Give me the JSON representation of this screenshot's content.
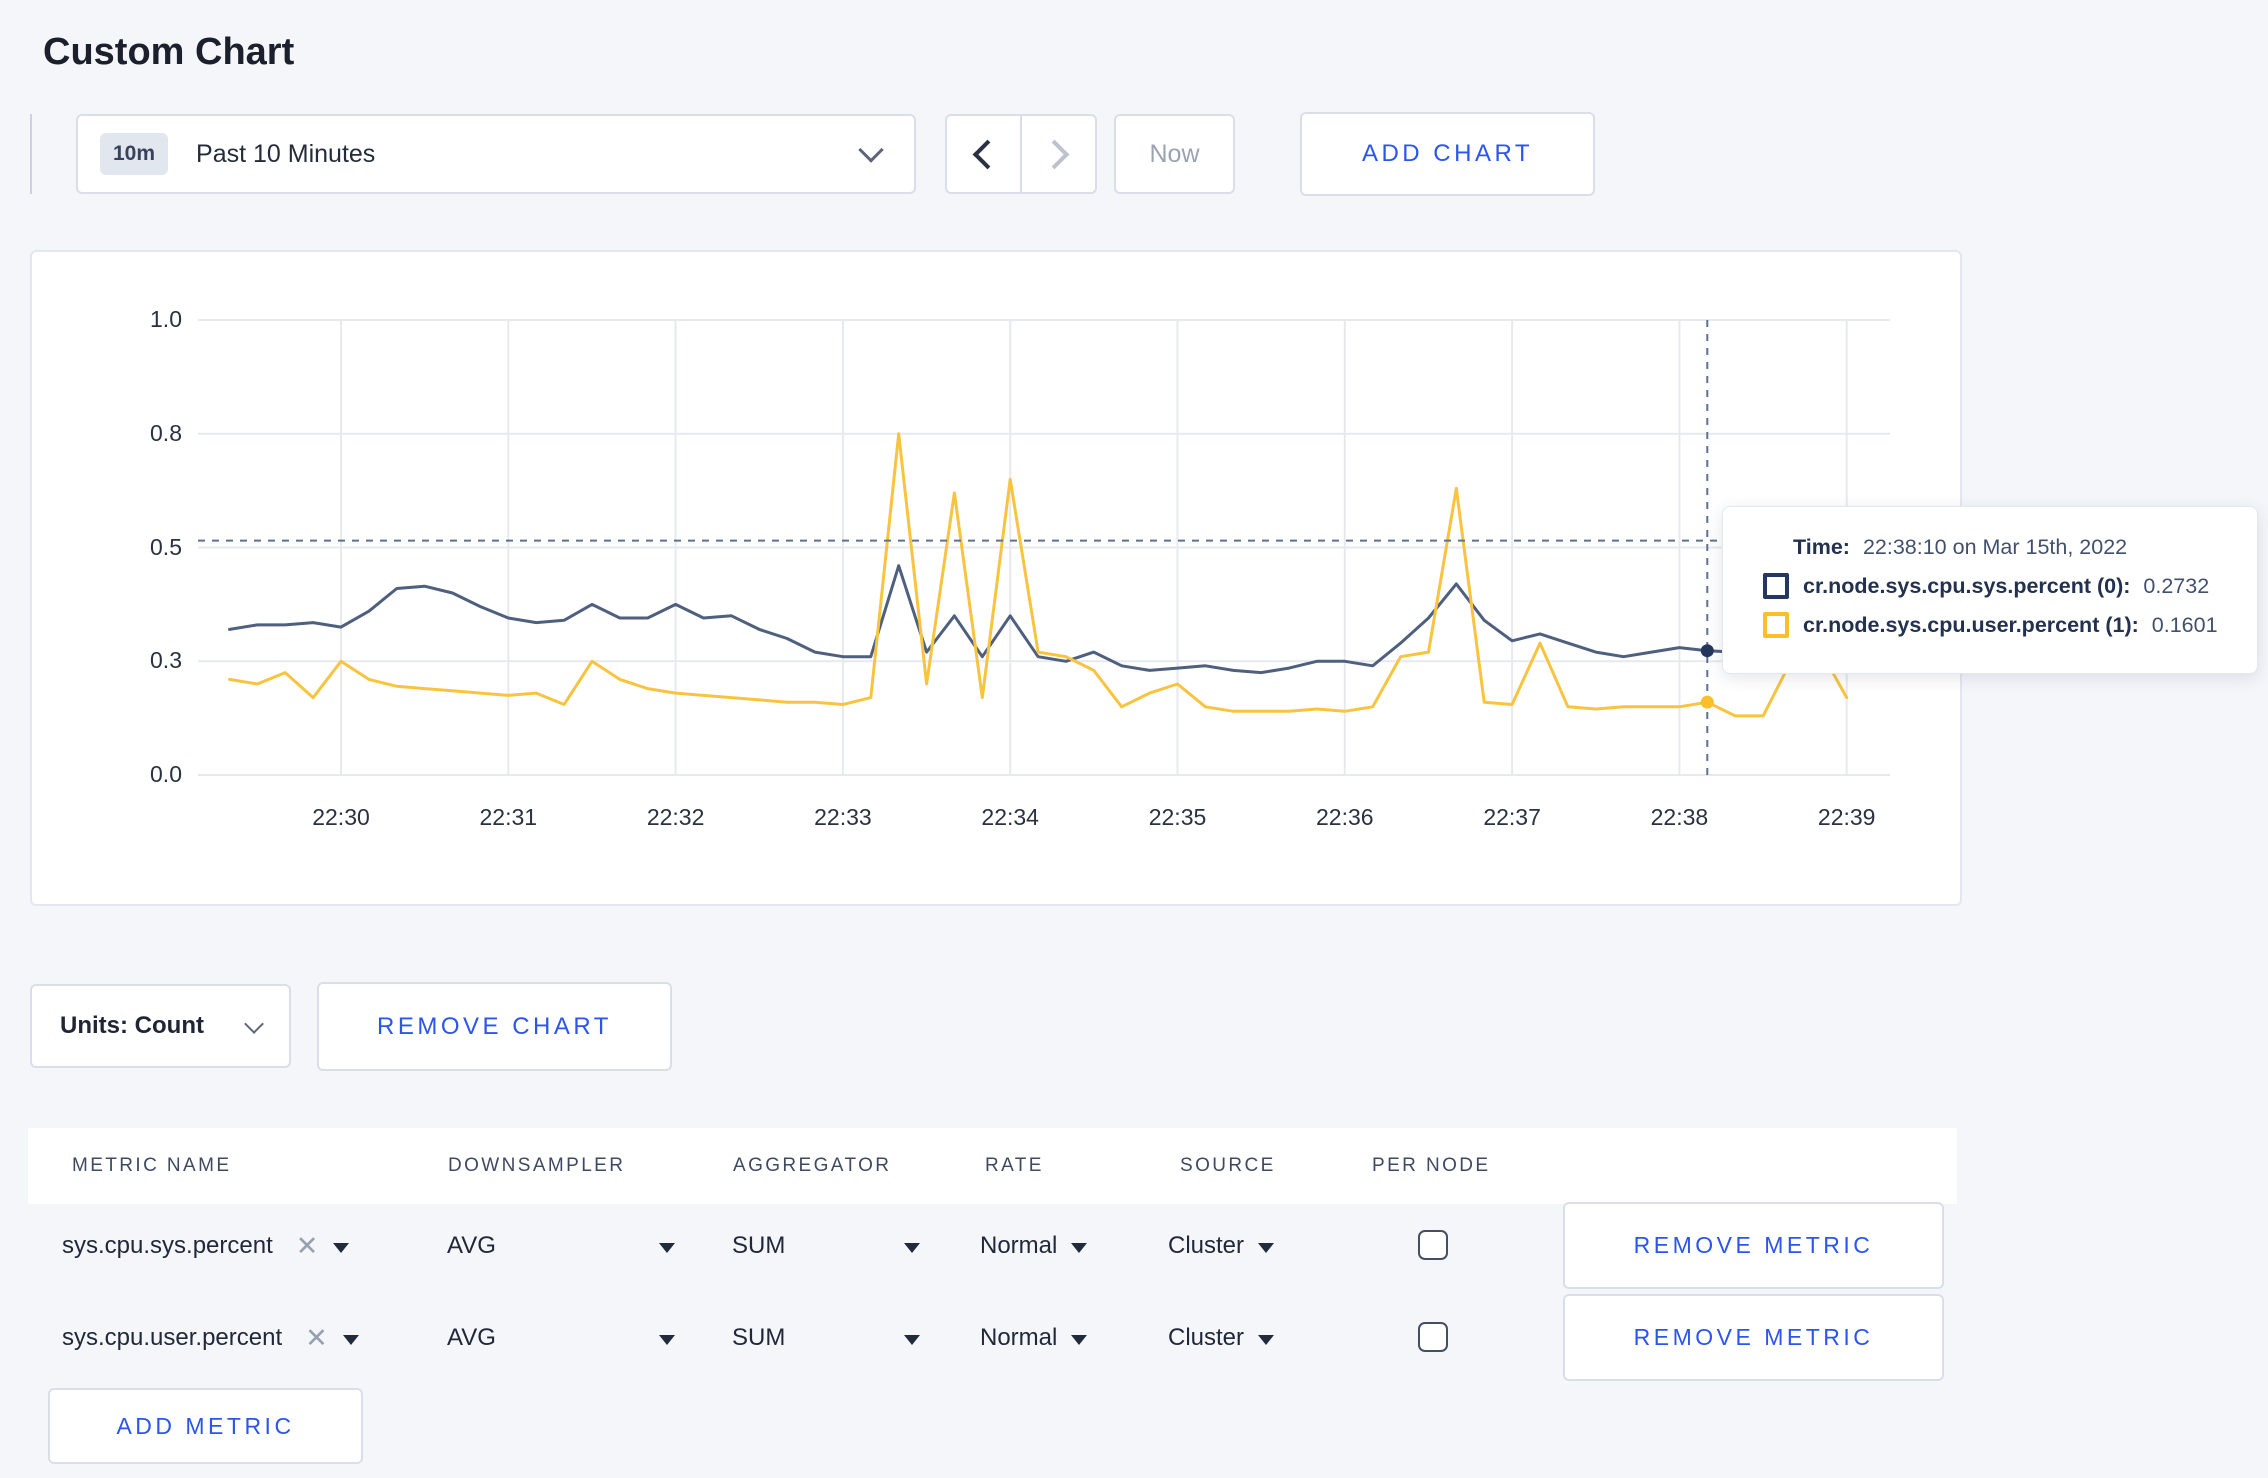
{
  "page": {
    "title": "Custom Chart"
  },
  "toolbar": {
    "range_badge": "10m",
    "range_label": "Past 10 Minutes",
    "now_label": "Now",
    "add_chart_label": "ADD CHART"
  },
  "chart": {
    "units_label": "Units: Count",
    "remove_chart_label": "REMOVE CHART"
  },
  "tooltip": {
    "time_label": "Time:",
    "time_value": "22:38:10 on Mar 15th, 2022",
    "series": [
      {
        "name": "cr.node.sys.cpu.sys.percent (0):",
        "value": "0.2732"
      },
      {
        "name": "cr.node.sys.cpu.user.percent (1):",
        "value": "0.1601"
      }
    ]
  },
  "table": {
    "headers": [
      "METRIC NAME",
      "DOWNSAMPLER",
      "AGGREGATOR",
      "RATE",
      "SOURCE",
      "PER NODE"
    ],
    "rows": [
      {
        "metric": "sys.cpu.sys.percent",
        "downsampler": "AVG",
        "aggregator": "SUM",
        "rate": "Normal",
        "source": "Cluster",
        "per_node_checked": false,
        "remove_label": "REMOVE METRIC"
      },
      {
        "metric": "sys.cpu.user.percent",
        "downsampler": "AVG",
        "aggregator": "SUM",
        "rate": "Normal",
        "source": "Cluster",
        "per_node_checked": false,
        "remove_label": "REMOVE METRIC"
      }
    ],
    "add_metric_label": "ADD METRIC"
  },
  "theme": {
    "accent_blue": "#2b55ee",
    "page_background": "#f4f6fa",
    "card_background": "#ffffff",
    "grid_line": "#e7e9ee",
    "crosshair": "#5d7292",
    "text_dark": "#232a3a",
    "muted_text": "#9aa3b2"
  },
  "chart_data": {
    "type": "line",
    "title": "",
    "xlabel": "",
    "ylabel": "",
    "ylim": [
      0,
      1
    ],
    "grid": true,
    "legend_position": "tooltip-only",
    "x_ticks": [
      "22:30",
      "22:31",
      "22:32",
      "22:33",
      "22:34",
      "22:35",
      "22:36",
      "22:37",
      "22:38",
      "22:39"
    ],
    "y_ticks": [
      {
        "value": 1.0,
        "label": "1.0"
      },
      {
        "value": 0.75,
        "label": "0.8"
      },
      {
        "value": 0.5,
        "label": "0.5"
      },
      {
        "value": 0.25,
        "label": "0.3"
      },
      {
        "value": 0.0,
        "label": "0.0"
      }
    ],
    "x_start_time": "22:29:20",
    "x_start_offset_seconds": -40,
    "x_step_seconds": 10,
    "series": [
      {
        "name": "cr.node.sys.cpu.sys.percent",
        "line_color": "#4f5f7e",
        "swatch_color": "#24375e",
        "values": [
          0.32,
          0.33,
          0.33,
          0.335,
          0.325,
          0.36,
          0.41,
          0.415,
          0.4,
          0.37,
          0.345,
          0.335,
          0.34,
          0.375,
          0.345,
          0.345,
          0.375,
          0.345,
          0.35,
          0.32,
          0.3,
          0.27,
          0.26,
          0.26,
          0.46,
          0.27,
          0.35,
          0.26,
          0.35,
          0.26,
          0.25,
          0.27,
          0.24,
          0.23,
          0.235,
          0.24,
          0.23,
          0.225,
          0.235,
          0.25,
          0.25,
          0.24,
          0.29,
          0.345,
          0.42,
          0.34,
          0.295,
          0.31,
          0.29,
          0.27,
          0.26,
          0.27,
          0.28,
          0.2732,
          0.27,
          0.27,
          0.28,
          0.29,
          0.3
        ]
      },
      {
        "name": "cr.node.sys.cpu.user.percent",
        "line_color": "#f8c440",
        "swatch_color": "#fbbf2d",
        "values": [
          0.21,
          0.2,
          0.225,
          0.17,
          0.25,
          0.21,
          0.195,
          0.19,
          0.185,
          0.18,
          0.175,
          0.18,
          0.155,
          0.25,
          0.21,
          0.19,
          0.18,
          0.175,
          0.17,
          0.165,
          0.16,
          0.16,
          0.155,
          0.17,
          0.75,
          0.2,
          0.62,
          0.17,
          0.65,
          0.27,
          0.26,
          0.23,
          0.15,
          0.18,
          0.2,
          0.15,
          0.14,
          0.14,
          0.14,
          0.145,
          0.14,
          0.15,
          0.26,
          0.27,
          0.63,
          0.16,
          0.155,
          0.29,
          0.15,
          0.145,
          0.15,
          0.15,
          0.15,
          0.1601,
          0.13,
          0.13,
          0.25,
          0.28,
          0.17
        ]
      }
    ],
    "crosshair": {
      "time": "22:38:10",
      "time_offset_seconds": 490,
      "mouse_y_value": 0.515,
      "point_values": [
        0.2732,
        0.1601
      ]
    }
  }
}
